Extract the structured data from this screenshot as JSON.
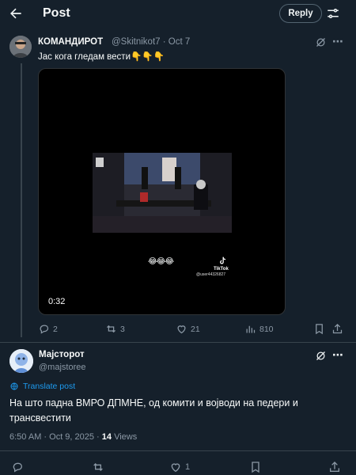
{
  "header": {
    "title": "Post",
    "reply_label": "Reply"
  },
  "tweet1": {
    "name": "КОМАНДИРОТ",
    "handle_date": "@Skitnikot7 · Oct 7",
    "text": "Јас кога гледам вести👇👇👇",
    "video_duration": "0:32",
    "video_emoji": "😂😂😂",
    "tiktok_label": "TikTok",
    "tiktok_user": "@user44326827",
    "actions": {
      "replies": "2",
      "reposts": "3",
      "likes": "21",
      "views": "810"
    }
  },
  "tweet2": {
    "name": "Мајсторот",
    "handle": "@majstoree",
    "translate_label": "Translate post",
    "text": "На што падна ВМРО ДПМНЕ, од комити и војводи на педери и трансвестити",
    "timestamp": "6:50 AM · Oct 9, 2025 · ",
    "views_count": "14",
    "views_label": " Views",
    "actions": {
      "likes": "1"
    }
  },
  "colors": {
    "background": "#15202b",
    "accent": "#1d9bf0",
    "muted": "#8b98a5"
  }
}
